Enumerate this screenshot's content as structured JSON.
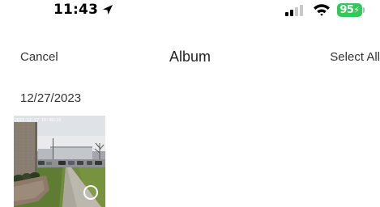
{
  "status_bar": {
    "time": "11:43",
    "battery_level": "95",
    "icons": [
      "location-arrow-icon",
      "cellular-signal-icon",
      "wifi-icon",
      "battery-charging-icon"
    ],
    "battery_color": "#34c759"
  },
  "nav": {
    "cancel_label": "Cancel",
    "title": "Album",
    "select_all_label": "Select All"
  },
  "album": {
    "sections": [
      {
        "date": "12/27/2023",
        "items": [
          {
            "timestamp_overlay": "2023-12-27 10:08:18",
            "selected": false
          }
        ]
      }
    ]
  }
}
